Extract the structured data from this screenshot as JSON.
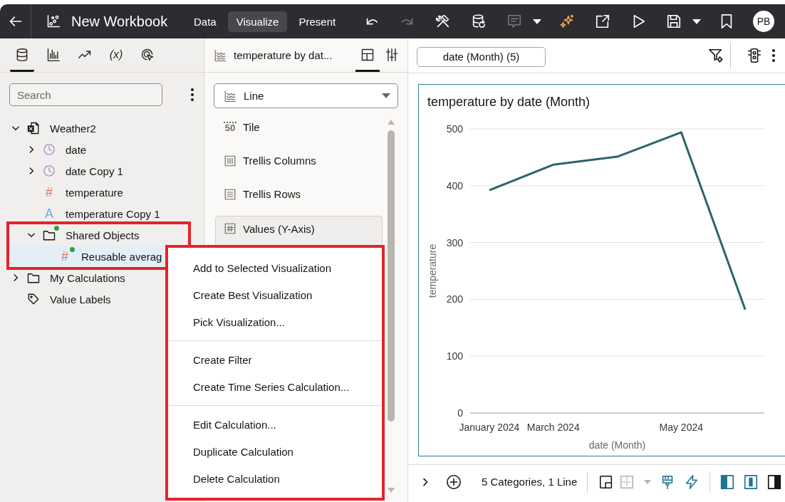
{
  "topbar": {
    "title": "New Workbook",
    "tabs": [
      {
        "label": "Data",
        "selected": false
      },
      {
        "label": "Visualize",
        "selected": true
      },
      {
        "label": "Present",
        "selected": false
      }
    ],
    "tools": [
      {
        "kind": "undo",
        "disabled": false
      },
      {
        "kind": "redo",
        "disabled": true
      },
      {
        "kind": "tools",
        "disabled": false
      },
      {
        "kind": "data-refresh",
        "disabled": false
      },
      {
        "kind": "comment",
        "disabled": true
      },
      {
        "kind": "menu-caret",
        "disabled": false
      },
      {
        "kind": "sparkle",
        "disabled": false
      },
      {
        "kind": "export",
        "disabled": false
      },
      {
        "kind": "play",
        "disabled": false
      },
      {
        "kind": "save",
        "disabled": false
      },
      {
        "kind": "menu-caret",
        "disabled": false
      },
      {
        "kind": "bookmark",
        "disabled": false
      }
    ],
    "avatar": "PB"
  },
  "data_panel": {
    "tabs": [
      {
        "kind": "data",
        "selected": true
      },
      {
        "kind": "visualizations",
        "selected": false
      },
      {
        "kind": "analytics",
        "selected": false
      },
      {
        "kind": "calculations",
        "glyph": "(x)",
        "selected": false
      },
      {
        "kind": "actions",
        "selected": false
      }
    ],
    "search": {
      "placeholder": "Search"
    },
    "tree": [
      {
        "label": "Weather2",
        "kind": "dataset",
        "expanded": true,
        "selected": false,
        "shared": false,
        "children": [
          {
            "label": "date",
            "kind": "date",
            "expanded": false,
            "selected": false,
            "shared": false
          },
          {
            "label": "date Copy 1",
            "kind": "date",
            "expanded": false,
            "selected": false,
            "shared": false
          },
          {
            "label": "temperature",
            "kind": "measure",
            "glyph": "#",
            "selected": false,
            "shared": false
          },
          {
            "label": "temperature Copy 1",
            "kind": "attribute",
            "glyph": "A",
            "selected": false,
            "shared": false
          },
          {
            "label": "Shared Objects",
            "kind": "folder",
            "expanded": true,
            "selected": false,
            "shared": true,
            "highlighted": true,
            "children": [
              {
                "label": "Reusable averag",
                "kind": "measure",
                "glyph": "#",
                "selected": true,
                "shared": true
              }
            ]
          }
        ]
      },
      {
        "label": "My Calculations",
        "kind": "folder",
        "expanded": false,
        "selected": false,
        "shared": false
      },
      {
        "label": "Value Labels",
        "kind": "tag",
        "selected": false,
        "shared": false
      }
    ]
  },
  "grammar_panel": {
    "title": "temperature by dat...",
    "tabs": [
      {
        "kind": "grammar",
        "selected": true
      },
      {
        "kind": "properties",
        "selected": false
      }
    ],
    "viz_type": "Line",
    "sections": [
      {
        "kind": "tile",
        "glyph": "50",
        "label": "Tile"
      },
      {
        "kind": "columns",
        "label": "Trellis Columns"
      },
      {
        "kind": "rows",
        "label": "Trellis Rows"
      },
      {
        "kind": "values",
        "label": "Values (Y-Axis)"
      }
    ]
  },
  "canvas": {
    "filter": "date (Month) (5)",
    "chart_data": {
      "type": "line",
      "title": "temperature by date (Month)",
      "xlabel": "date (Month)",
      "ylabel": "temperature",
      "categories": [
        "January 2024",
        "March 2024",
        null,
        "May 2024",
        null
      ],
      "values": [
        392,
        437,
        451,
        494,
        182
      ],
      "ylim": [
        0,
        500
      ],
      "yticks": [
        0,
        100,
        200,
        300,
        400,
        500
      ],
      "grid": true
    },
    "status": "5 Categories, 1 Line",
    "footer_tools": [
      {
        "kind": "frame",
        "disabled": false
      },
      {
        "kind": "grid",
        "disabled": true
      },
      {
        "kind": "menu-caret",
        "disabled": true
      },
      {
        "kind": "brush",
        "disabled": false
      },
      {
        "kind": "lightning",
        "disabled": false
      }
    ],
    "panels": [
      {
        "kind": "left",
        "on": true
      },
      {
        "kind": "center",
        "on": true
      },
      {
        "kind": "right",
        "on": false
      }
    ]
  },
  "context_menu": {
    "highlighted": true,
    "groups": [
      {
        "items": [
          "Add to Selected Visualization",
          "Create Best Visualization",
          "Pick Visualization..."
        ]
      },
      {
        "items": [
          "Create Filter",
          "Create Time Series Calculation..."
        ]
      },
      {
        "items": [
          "Edit Calculation...",
          "Duplicate Calculation",
          "Delete Calculation"
        ]
      }
    ]
  }
}
